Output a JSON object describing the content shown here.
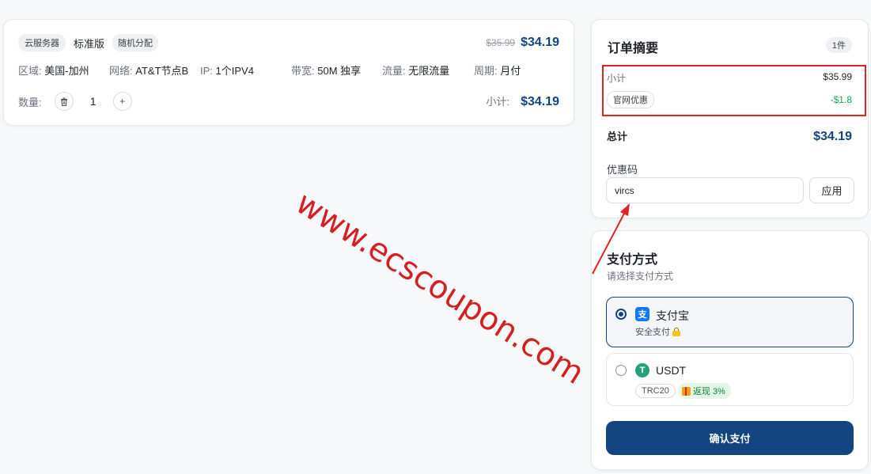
{
  "product": {
    "category": "云服务器",
    "plan": "标准版",
    "allocation": "随机分配",
    "original_price": "$35.99",
    "price": "$34.19",
    "specs": [
      {
        "key": "区域:",
        "value": "美国-加州"
      },
      {
        "key": "网络:",
        "value": "AT&T节点B"
      },
      {
        "key": "IP:",
        "value": "1个IPV4"
      },
      {
        "key": "带宽:",
        "value": "50M 独享"
      },
      {
        "key": "流量:",
        "value": "无限流量"
      },
      {
        "key": "周期:",
        "value": "月付"
      }
    ],
    "quantity_label": "数量:",
    "quantity": "1",
    "minus_icon": "trash-icon",
    "plus_symbol": "+",
    "subtotal_label": "小计:",
    "subtotal": "$34.19"
  },
  "summary": {
    "title": "订单摘要",
    "count": "1件",
    "subtotal_label": "小计",
    "subtotal": "$35.99",
    "discount_label": "官网优惠",
    "discount": "-$1.8",
    "total_label": "总计",
    "total": "$34.19",
    "coupon_label": "优惠码",
    "coupon_value": "vircs",
    "apply_label": "应用"
  },
  "payment": {
    "title": "支付方式",
    "subtitle": "请选择支付方式",
    "options": [
      {
        "name": "支付宝",
        "note": "安全支付",
        "selected": true,
        "icon": "alipay-icon"
      },
      {
        "name": "USDT",
        "network": "TRC20",
        "cashback": "返现 3%",
        "selected": false,
        "icon": "usdt-icon"
      }
    ],
    "confirm_label": "确认支付"
  },
  "overlay": {
    "watermark": "www.ecscoupon.com"
  },
  "colors": {
    "primary": "#14447f",
    "discount_green": "#16a34a",
    "highlight_red": "#e02424",
    "watermark_red": "#d42020"
  }
}
